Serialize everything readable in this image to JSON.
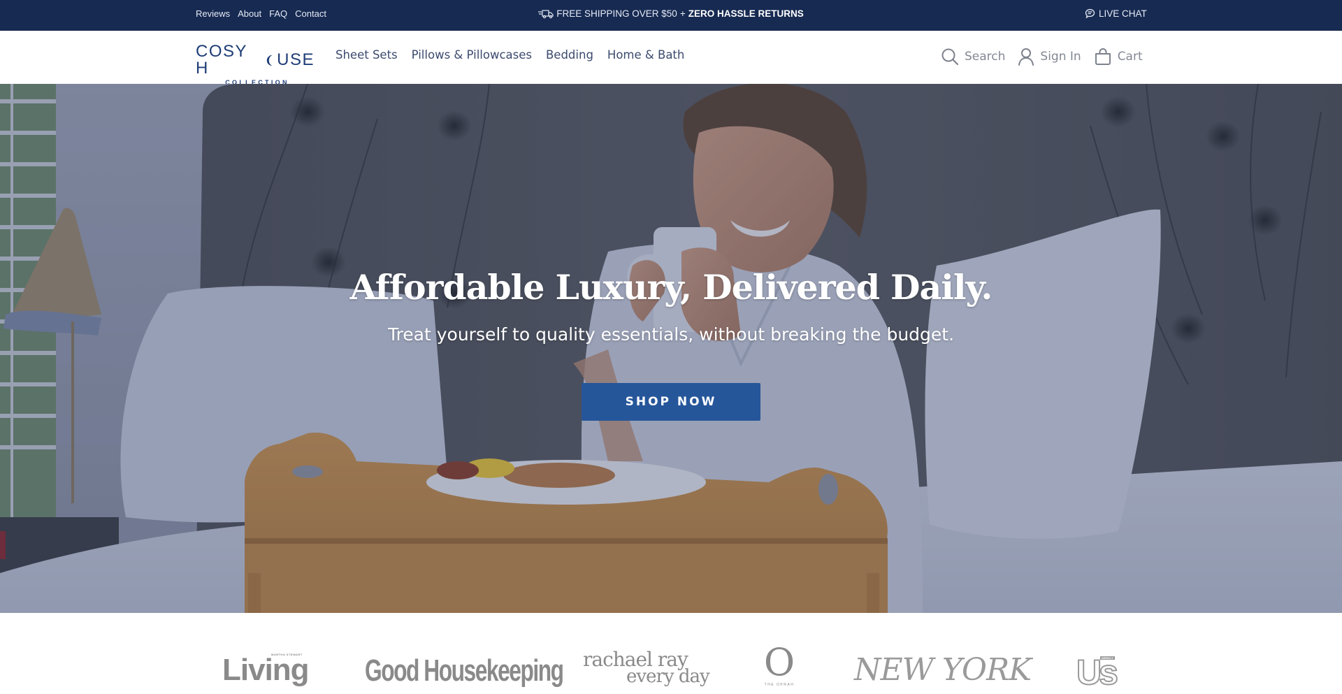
{
  "topbar": {
    "links": [
      "Reviews",
      "About",
      "FAQ",
      "Contact"
    ],
    "promo_regular": "FREE SHIPPING OVER $50",
    "promo_separator": "+",
    "promo_bold": "ZERO HASSLE RETURNS",
    "live_chat": "LIVE CHAT",
    "background": "#172a52"
  },
  "header": {
    "logo_main_left": "COSY H",
    "logo_main_right": "USE",
    "logo_sub": "COLLECTION",
    "nav": [
      "Sheet Sets",
      "Pillows & Pillowcases",
      "Bedding",
      "Home & Bath"
    ],
    "actions": {
      "search": "Search",
      "sign_in": "Sign In",
      "cart": "Cart"
    }
  },
  "hero": {
    "title": "Affordable Luxury, Delivered Daily.",
    "subtitle": "Treat yourself to quality essentials, without breaking the budget.",
    "cta": "SHOP NOW",
    "cta_color": "#26569a"
  },
  "press": {
    "logos": [
      {
        "name": "Living",
        "kicker": "MARTHA STEWART"
      },
      {
        "name": "Good Housekeeping"
      },
      {
        "name": "rachael ray",
        "line2": "every day"
      },
      {
        "name": "O",
        "kicker": "THE OPRAH"
      },
      {
        "name": "New York"
      },
      {
        "name": "Us",
        "kicker": "WEEKLY"
      }
    ]
  }
}
